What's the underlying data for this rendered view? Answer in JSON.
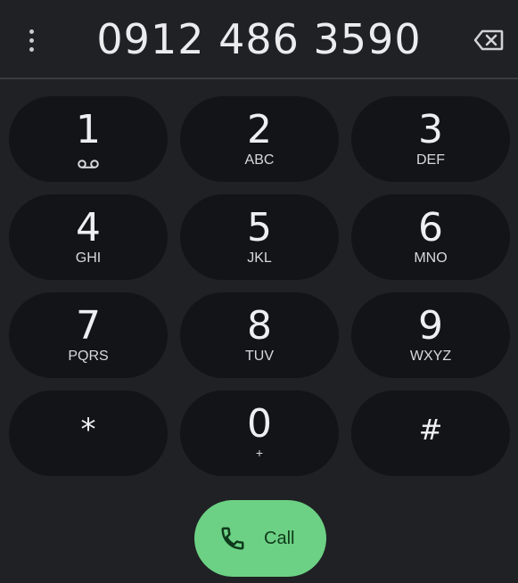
{
  "dialer": {
    "number": "0912 486 3590",
    "menu_icon": "more-vert-icon",
    "backspace_icon": "backspace-icon"
  },
  "keypad": {
    "keys": [
      {
        "digit": "1",
        "letters": "",
        "icon": "voicemail-icon"
      },
      {
        "digit": "2",
        "letters": "ABC"
      },
      {
        "digit": "3",
        "letters": "DEF"
      },
      {
        "digit": "4",
        "letters": "GHI"
      },
      {
        "digit": "5",
        "letters": "JKL"
      },
      {
        "digit": "6",
        "letters": "MNO"
      },
      {
        "digit": "7",
        "letters": "PQRS"
      },
      {
        "digit": "8",
        "letters": "TUV"
      },
      {
        "digit": "9",
        "letters": "WXYZ"
      },
      {
        "digit": "*",
        "letters": ""
      },
      {
        "digit": "0",
        "letters": "+"
      },
      {
        "digit": "#",
        "letters": ""
      }
    ]
  },
  "call": {
    "label": "Call",
    "icon": "phone-icon",
    "color": "#6cd184"
  },
  "colors": {
    "background": "#1f2124",
    "key_background": "#121417"
  }
}
